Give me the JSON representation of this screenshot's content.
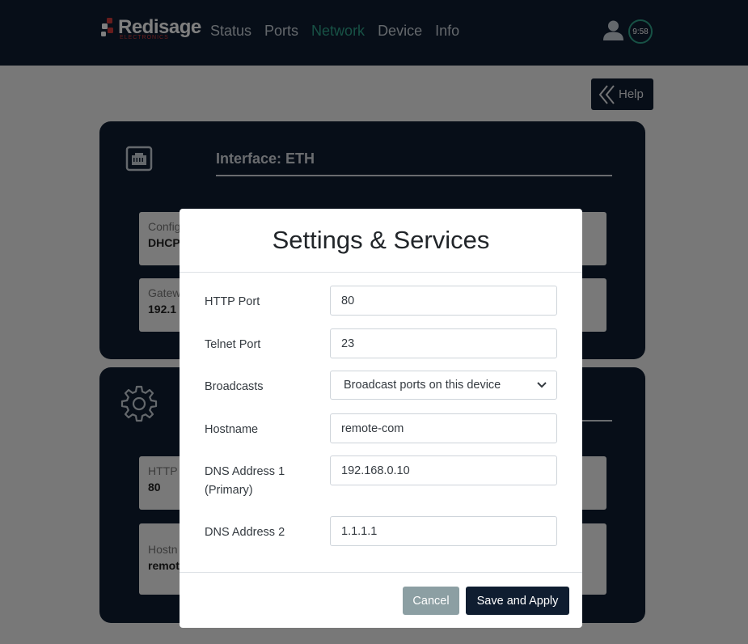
{
  "brand": {
    "name": "Redisage",
    "sub": "ELECTRONICS"
  },
  "nav": {
    "items": [
      {
        "label": "Status"
      },
      {
        "label": "Ports"
      },
      {
        "label": "Network",
        "active": true
      },
      {
        "label": "Device"
      },
      {
        "label": "Info"
      }
    ],
    "timer": "9:58"
  },
  "help": {
    "label": "Help"
  },
  "card_interface": {
    "title": "Interface: ETH",
    "fields": [
      {
        "label": "Config",
        "value": "DHCP"
      },
      {
        "label": "Gatew",
        "value": "192.1"
      }
    ]
  },
  "card_settings": {
    "fields": [
      {
        "label": "HTTP",
        "value": "80"
      },
      {
        "label": "Hostn",
        "value": "remot"
      }
    ]
  },
  "modal": {
    "title": "Settings & Services",
    "http_port": {
      "label": "HTTP Port",
      "value": "80"
    },
    "telnet_port": {
      "label": "Telnet Port",
      "value": "23"
    },
    "broadcasts": {
      "label": "Broadcasts",
      "value": "Broadcast ports on this device"
    },
    "hostname": {
      "label": "Hostname",
      "value": "remote-com"
    },
    "dns1": {
      "label": "DNS Address 1 (Primary)",
      "value": "192.168.0.10"
    },
    "dns2": {
      "label": "DNS Address 2",
      "value": "1.1.1.1"
    },
    "cancel_label": "Cancel",
    "save_label": "Save and Apply"
  },
  "colors": {
    "navy": "#0f1d30",
    "accent": "#2fa38a",
    "brand_red": "#d13b3b",
    "cancel": "#8c9fa3"
  },
  "icons": [
    "brand-logo-icon",
    "user-icon",
    "double-chevron-left-icon",
    "ethernet-port-icon",
    "gear-icon",
    "chevron-down-icon"
  ]
}
